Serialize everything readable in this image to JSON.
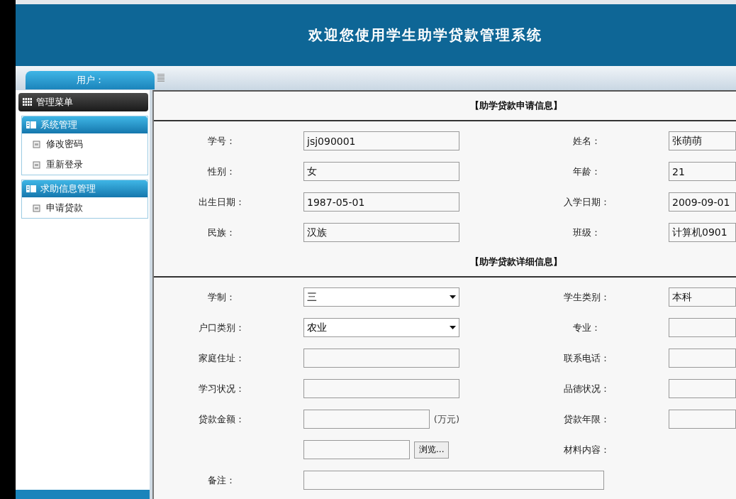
{
  "header": {
    "title": "欢迎您使用学生助学贷款管理系统"
  },
  "user_tab": {
    "label": "用户："
  },
  "sidebar": {
    "title": "管理菜单",
    "groups": [
      {
        "title": "系统管理",
        "items": [
          {
            "label": "修改密码"
          },
          {
            "label": "重新登录"
          }
        ]
      },
      {
        "title": "求助信息管理",
        "items": [
          {
            "label": "申请贷款"
          }
        ]
      }
    ]
  },
  "sections": [
    {
      "title": "【助学贷款申请信息】",
      "rows": [
        [
          {
            "label": "学号：",
            "kind": "text",
            "value": "jsj090001"
          },
          {
            "label": "姓名：",
            "kind": "text",
            "value": "张萌萌"
          }
        ],
        [
          {
            "label": "性别：",
            "kind": "text",
            "value": "女"
          },
          {
            "label": "年龄：",
            "kind": "text",
            "value": "21"
          }
        ],
        [
          {
            "label": "出生日期：",
            "kind": "text",
            "value": "1987-05-01"
          },
          {
            "label": "入学日期：",
            "kind": "text",
            "value": "2009-09-01"
          }
        ],
        [
          {
            "label": "民族：",
            "kind": "text",
            "value": "汉族"
          },
          {
            "label": "班级：",
            "kind": "text",
            "value": "计算机0901"
          }
        ]
      ]
    },
    {
      "title": "【助学贷款详细信息】",
      "rows": [
        [
          {
            "label": "学制：",
            "kind": "select",
            "value": "三"
          },
          {
            "label": "学生类别：",
            "kind": "text",
            "value": "本科"
          }
        ],
        [
          {
            "label": "户口类别：",
            "kind": "select",
            "value": "农业"
          },
          {
            "label": "专业：",
            "kind": "text"
          }
        ],
        [
          {
            "label": "家庭住址：",
            "kind": "text"
          },
          {
            "label": "联系电话：",
            "kind": "text"
          }
        ],
        [
          {
            "label": "学习状况：",
            "kind": "text"
          },
          {
            "label": "品德状况：",
            "kind": "text"
          }
        ],
        [
          {
            "label": "贷款金额：",
            "kind": "text",
            "unit": "(万元)"
          },
          {
            "label": "贷款年限：",
            "kind": "text"
          }
        ],
        [
          {
            "kind": "file",
            "button": "浏览..."
          },
          {
            "label": "材料内容：",
            "kind": "none"
          }
        ],
        [
          {
            "label": "备注：",
            "kind": "wide"
          }
        ]
      ]
    }
  ]
}
